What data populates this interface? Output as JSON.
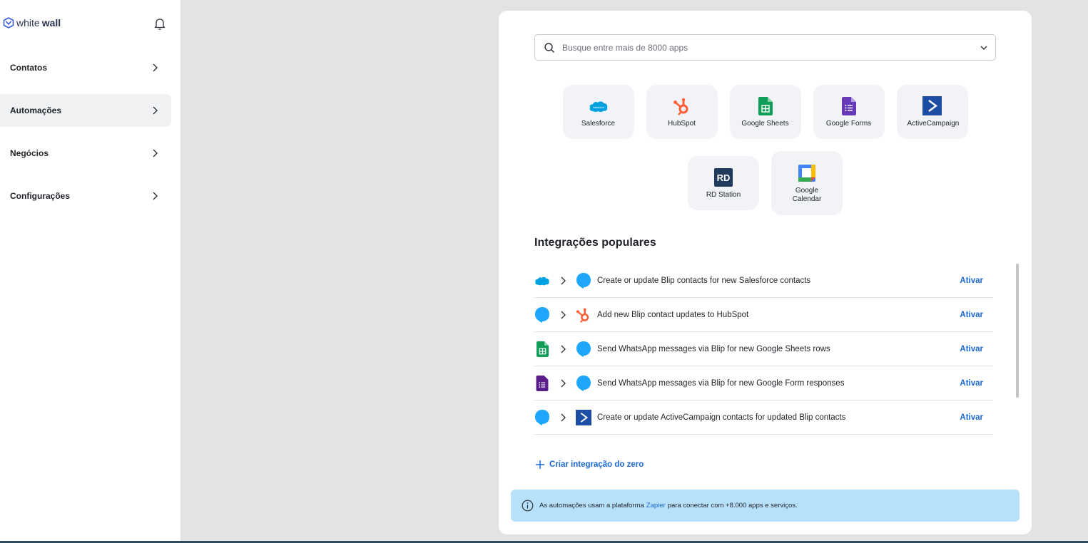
{
  "brand": {
    "part1": "white",
    "part2": "wall"
  },
  "sidebar": {
    "items": [
      {
        "label": "Contatos",
        "active": false
      },
      {
        "label": "Automações",
        "active": true
      },
      {
        "label": "Negócios",
        "active": false
      },
      {
        "label": "Configurações",
        "active": false
      }
    ]
  },
  "search": {
    "placeholder": "Busque entre mais de 8000 apps",
    "value": ""
  },
  "apps": [
    {
      "label": "Salesforce",
      "icon": "salesforce-icon"
    },
    {
      "label": "HubSpot",
      "icon": "hubspot-icon"
    },
    {
      "label": "Google Sheets",
      "icon": "google-sheets-icon"
    },
    {
      "label": "Google Forms",
      "icon": "google-forms-icon"
    },
    {
      "label": "ActiveCampaign",
      "icon": "activecampaign-icon"
    },
    {
      "label": "RD Station",
      "icon": "rd-station-icon",
      "icon_text": "RD"
    },
    {
      "label": "Google Calendar",
      "icon": "google-calendar-icon"
    }
  ],
  "popular": {
    "title": "Integrações populares",
    "action_label": "Ativar",
    "items": [
      {
        "from": "salesforce-icon",
        "to": "blip-icon",
        "text": "Create or update Blip contacts for new Salesforce contacts"
      },
      {
        "from": "blip-icon",
        "to": "hubspot-icon",
        "text": "Add new Blip contact updates to HubSpot"
      },
      {
        "from": "google-sheets-icon",
        "to": "blip-icon",
        "text": "Send WhatsApp messages via Blip for new Google Sheets rows"
      },
      {
        "from": "google-forms-icon",
        "to": "blip-icon",
        "text": "Send WhatsApp messages via Blip for new Google Form responses"
      },
      {
        "from": "blip-icon",
        "to": "activecampaign-icon",
        "text": "Create or update ActiveCampaign contacts for updated Blip contacts"
      }
    ]
  },
  "create_label": "Criar integração do zero",
  "info": {
    "before": "As automações usam a plataforma",
    "link": "Zapier",
    "after": "para conectar com +8.000 apps e serviços."
  },
  "colors": {
    "accent": "#1968d2",
    "info_bg": "#b7e0fa",
    "salesforce": "#00a1e0",
    "hubspot": "#ff5c35",
    "sheets": "#0f9d58",
    "forms": "#673ab7",
    "activecampaign": "#356ae6",
    "blip": "#1ea7fd"
  }
}
